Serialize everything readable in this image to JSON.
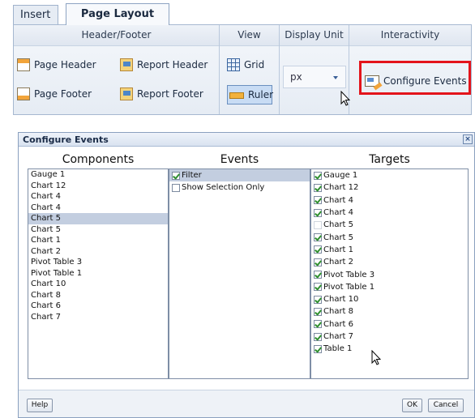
{
  "ribbon": {
    "tabs": [
      "Insert",
      "Page Layout"
    ],
    "groups": {
      "header_footer": {
        "title": "Header/Footer",
        "page_header": "Page Header",
        "report_header": "Report Header",
        "page_footer": "Page Footer",
        "report_footer": "Report Footer"
      },
      "view": {
        "title": "View",
        "grid": "Grid",
        "ruler": "Ruler"
      },
      "display_unit": {
        "title": "Display Unit",
        "value": "px"
      },
      "interactivity": {
        "title": "Interactivity",
        "configure_events": "Configure Events"
      }
    },
    "colors": {
      "highlight": "#e3141b"
    }
  },
  "dialog": {
    "title": "Configure Events",
    "headers": {
      "components": "Components",
      "events": "Events",
      "targets": "Targets"
    },
    "components": [
      "Gauge 1",
      "Chart 12",
      "Chart 4",
      "Chart 4",
      "Chart 5",
      "Chart 5",
      "Chart 1",
      "Chart 2",
      "Pivot Table 3",
      "Pivot Table 1",
      "Chart 10",
      "Chart 8",
      "Chart 6",
      "Chart 7"
    ],
    "selected_component_index": 4,
    "events": [
      {
        "label": "Filter",
        "checked": true,
        "selected": true
      },
      {
        "label": "Show Selection Only",
        "checked": false,
        "selected": false
      }
    ],
    "targets": [
      {
        "label": "Gauge 1",
        "checked": true
      },
      {
        "label": "Chart 12",
        "checked": true
      },
      {
        "label": "Chart 4",
        "checked": true
      },
      {
        "label": "Chart 4",
        "checked": true
      },
      {
        "label": "Chart 5",
        "checked": false
      },
      {
        "label": "Chart 5",
        "checked": true
      },
      {
        "label": "Chart 1",
        "checked": true
      },
      {
        "label": "Chart 2",
        "checked": true
      },
      {
        "label": "Pivot Table 3",
        "checked": true
      },
      {
        "label": "Pivot Table 1",
        "checked": true
      },
      {
        "label": "Chart 10",
        "checked": true
      },
      {
        "label": "Chart 8",
        "checked": true
      },
      {
        "label": "Chart 6",
        "checked": true
      },
      {
        "label": "Chart 7",
        "checked": true
      },
      {
        "label": "Table 1",
        "checked": true
      }
    ],
    "buttons": {
      "help": "Help",
      "ok": "OK",
      "cancel": "Cancel"
    }
  }
}
